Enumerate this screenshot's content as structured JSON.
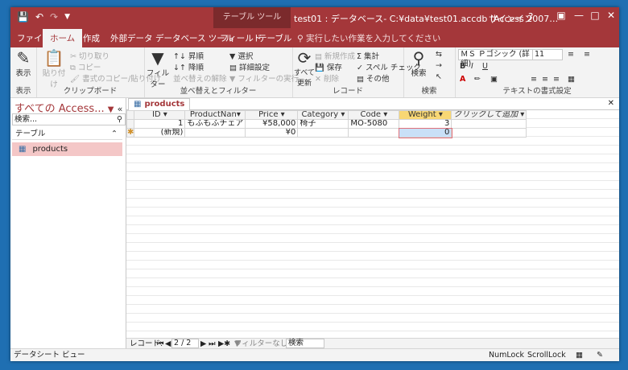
{
  "title_bar": {
    "qat_save_icon": "save-icon",
    "qat_undo_icon": "undo-icon",
    "qat_redo_icon": "redo-icon",
    "contextual_tool": "テーブル ツール",
    "title": "test01 : データベース- C:¥data¥test01.accdb (Access 2007…",
    "sign_in": "サインイン",
    "help": "?"
  },
  "tabs": [
    "ファイル",
    "ホーム",
    "作成",
    "外部データ",
    "データベース ツール",
    "フィールド",
    "テーブル"
  ],
  "active_tab": "ホーム",
  "tell_me": "実行したい作業を入力してください",
  "ribbon": {
    "views": {
      "button": "表示",
      "label": "表示"
    },
    "clipboard": {
      "paste": "貼り付け",
      "cut": "切り取り",
      "copy": "コピー",
      "format_painter": "書式のコピー/貼り付け",
      "label": "クリップボード"
    },
    "sort_filter": {
      "filter": "フィルター",
      "ascending": "昇順",
      "descending": "降順",
      "remove_sort": "並べ替えの解除",
      "selection": "選択",
      "advanced": "詳細設定",
      "toggle_filter": "フィルターの実行",
      "label": "並べ替えとフィルター"
    },
    "records": {
      "refresh": "すべて更新",
      "new": "新規作成",
      "save": "保存",
      "delete": "削除",
      "totals": "集計",
      "spelling": "スペル チェック",
      "more": "その他",
      "label": "レコード"
    },
    "find": {
      "find": "検索",
      "label": "検索"
    },
    "text_format": {
      "font": "ＭＳ Ｐゴシック (詳細)",
      "size": "11",
      "bold": "B",
      "italic": "I",
      "underline": "U",
      "label": "テキストの書式設定"
    }
  },
  "nav_pane": {
    "title": "すべての Access...",
    "search_placeholder": "検索...",
    "group": "テーブル",
    "items": [
      "products"
    ]
  },
  "document_tab": "products",
  "datasheet": {
    "columns": [
      "ID",
      "ProductNan",
      "Price",
      "Category",
      "Code",
      "Weight",
      "クリックして追加"
    ],
    "rows": [
      {
        "id": "1",
        "product_name": "もふもふチェア",
        "price": "¥58,000",
        "category": "椅子",
        "code": "MO-5080",
        "weight": "3"
      }
    ],
    "new_row": {
      "id": "(新規)",
      "price": "¥0",
      "weight": "0"
    }
  },
  "record_nav": {
    "label": "レコード:",
    "position": "2 / 2",
    "filter": "フィルターなし",
    "search": "検索"
  },
  "status": {
    "view": "データシート ビュー",
    "numlock": "NumLock",
    "scrolllock": "ScrollLock"
  }
}
